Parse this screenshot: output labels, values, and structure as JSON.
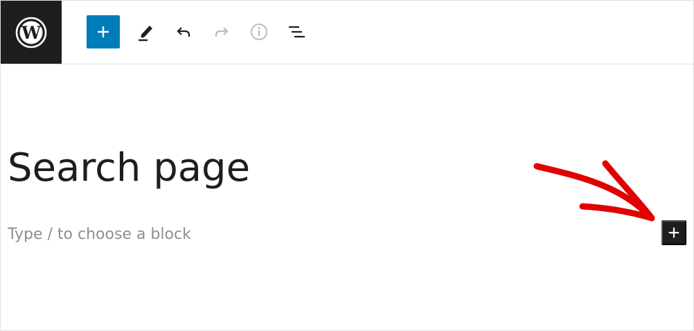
{
  "toolbar": {
    "logo_icon": "wordpress-logo-icon",
    "inserter_icon": "plus-icon",
    "tools_icon": "pencil-icon",
    "undo_icon": "undo-icon",
    "redo_icon": "redo-icon",
    "info_icon": "info-icon",
    "outline_icon": "list-view-icon",
    "colors": {
      "logo_bg": "#1e1e1e",
      "inserter_bg": "#007cba",
      "icon_active": "#1e1e1e",
      "icon_disabled": "#bbbbbb"
    }
  },
  "editor": {
    "title": "Search page",
    "placeholder": "Type / to choose a block",
    "block_inserter_icon": "plus-icon"
  },
  "annotation": {
    "type": "arrow",
    "color": "#e10000"
  }
}
